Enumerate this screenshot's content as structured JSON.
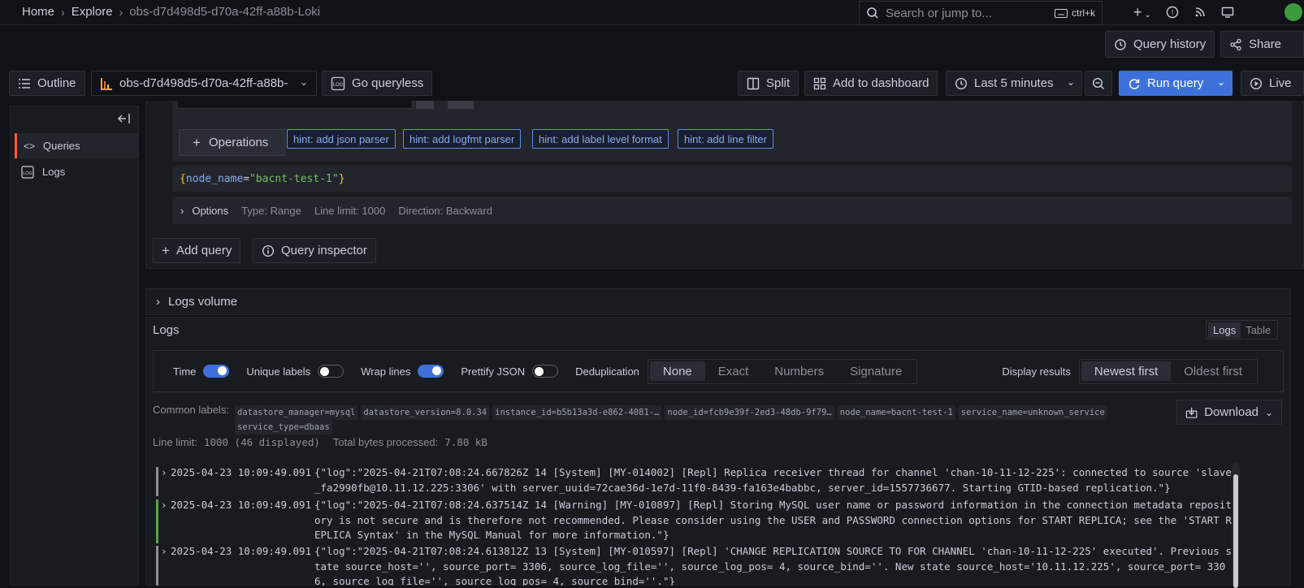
{
  "breadcrumbs": {
    "home": "Home",
    "explore": "Explore",
    "current": "obs-d7d498d5-d70a-42ff-a88b-Loki"
  },
  "search": {
    "placeholder": "Search or jump to...",
    "shortcut": "ctrl+k"
  },
  "header": {
    "query_history": "Query history",
    "share": "Share"
  },
  "toolbar": {
    "outline": "Outline",
    "datasource": "obs-d7d498d5-d70a-42ff-a88b-",
    "go_queryless": "Go queryless",
    "split": "Split",
    "add_to_dashboard": "Add to dashboard",
    "time_range": "Last 5 minutes",
    "run_query": "Run query",
    "live": "Live"
  },
  "sidebar": {
    "items": [
      {
        "label": "Queries",
        "icon": "code-icon"
      },
      {
        "label": "Logs",
        "icon": "logs-icon"
      }
    ]
  },
  "query": {
    "operations": "Operations",
    "hints": [
      "hint: add json parser",
      "hint: add logfmt parser",
      "hint: add label level format",
      "hint: add line filter"
    ],
    "expr_open": "{",
    "expr_key": "node_name",
    "expr_eq": "=",
    "expr_val": "\"bacnt-test-1\"",
    "expr_close": "}",
    "options": {
      "label": "Options",
      "type": "Type: Range",
      "line_limit": "Line limit: 1000",
      "direction": "Direction: Backward"
    },
    "add_query": "Add query",
    "query_inspector": "Query inspector"
  },
  "logs_volume": {
    "label": "Logs volume"
  },
  "logs": {
    "title": "Logs",
    "view_tabs": [
      "Logs",
      "Table"
    ],
    "controls": {
      "time": "Time",
      "unique_labels": "Unique labels",
      "wrap_lines": "Wrap lines",
      "prettify_json": "Prettify JSON",
      "deduplication": "Deduplication",
      "dedup_options": [
        "None",
        "Exact",
        "Numbers",
        "Signature"
      ],
      "display_results": "Display results",
      "order_options": [
        "Newest first",
        "Oldest first"
      ]
    },
    "common_labels_title": "Common labels:",
    "common_labels": [
      "datastore_manager=mysql",
      "datastore_version=8.0.34",
      "instance_id=b5b13a3d-e862-4081-…",
      "node_id=fcb9e39f-2ed3-48db-9f79…",
      "node_name=bacnt-test-1",
      "service_name=unknown_service",
      "service_type=dbaas"
    ],
    "line_limit_label": "Line limit:",
    "line_limit_value": "1000 (46 displayed)",
    "bytes_label": "Total bytes processed:",
    "bytes_value": "7.80 kB",
    "download": "Download",
    "rows": [
      {
        "time": "2025-04-23 10:09:49.091",
        "level_color": "#8e8e9a",
        "message": "{\"log\":\"2025-04-21T07:08:24.667826Z 14 [System] [MY-014002] [Repl] Replica receiver thread for channel 'chan-10-11-12-225': connected to source 'slave_fa2990fb@10.11.12.225:3306' with server_uuid=72cae36d-1e7d-11f0-8439-fa163e4babbc, server_id=1557736677. Starting GTID-based replication.\"}"
      },
      {
        "time": "2025-04-23 10:09:49.091",
        "level_color": "#56a64b",
        "message": "{\"log\":\"2025-04-21T07:08:24.637514Z 14 [Warning] [MY-010897] [Repl] Storing MySQL user name or password information in the connection metadata repository is not secure and is therefore not recommended. Please consider using the USER and PASSWORD connection options for START REPLICA; see the 'START REPLICA Syntax' in the MySQL Manual for more information.\"}"
      },
      {
        "time": "2025-04-23 10:09:49.091",
        "level_color": "#8e8e9a",
        "message": "{\"log\":\"2025-04-21T07:08:24.613812Z 13 [System] [MY-010597] [Repl] 'CHANGE REPLICATION SOURCE TO FOR CHANNEL 'chan-10-11-12-225' executed'. Previous state source_host='', source_port= 3306, source_log_file='', source_log_pos= 4, source_bind=''. New state source_host='10.11.12.225', source_port= 3306, source_log_file='', source_log_pos= 4, source_bind=''.\"}"
      }
    ]
  }
}
